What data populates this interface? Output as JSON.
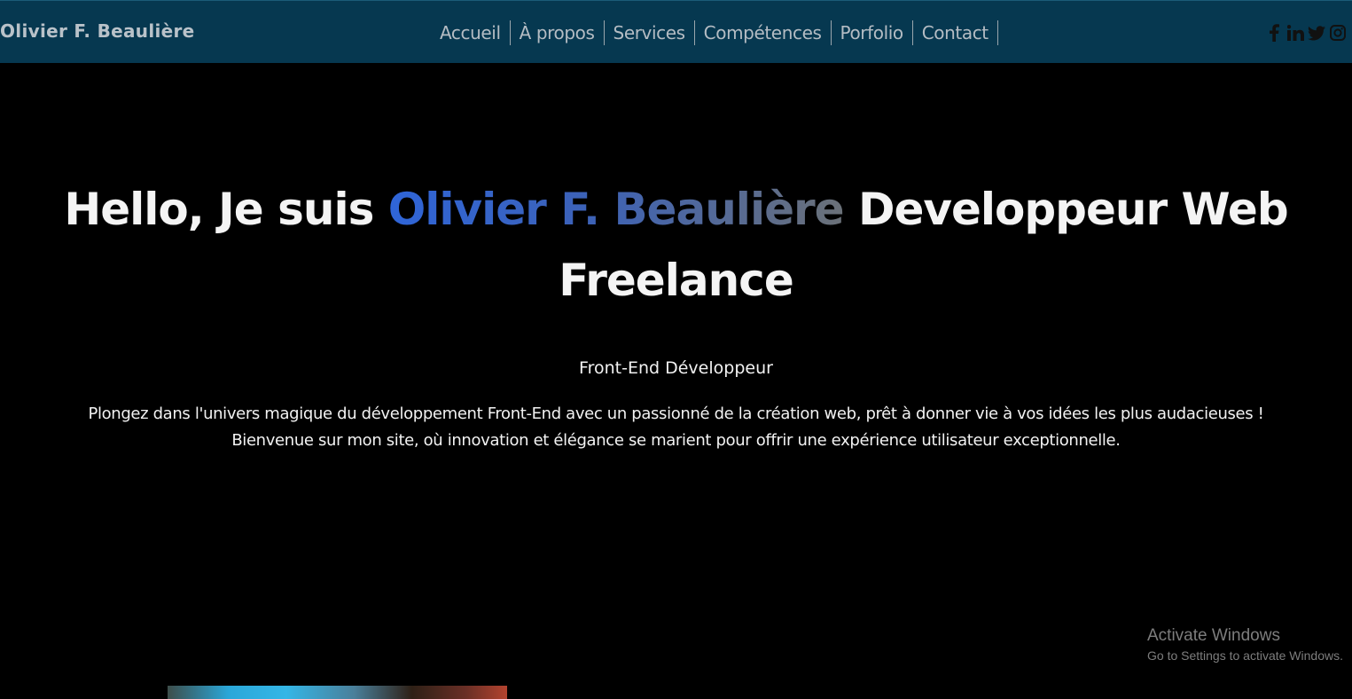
{
  "brand": {
    "name": "Olivier F. Beaulière"
  },
  "nav": {
    "links": [
      {
        "label": "Accueil"
      },
      {
        "label": "À propos"
      },
      {
        "label": "Services"
      },
      {
        "label": "Compétences"
      },
      {
        "label": "Porfolio"
      },
      {
        "label": "Contact"
      }
    ]
  },
  "socials": [
    {
      "icon": "facebook-icon"
    },
    {
      "icon": "linkedin-icon"
    },
    {
      "icon": "twitter-icon"
    },
    {
      "icon": "instagram-icon"
    }
  ],
  "hero": {
    "title_prefix": "Hello, Je suis ",
    "title_name": "Olivier F. Beaulière",
    "title_suffix": " Developpeur Web Freelance",
    "subtitle": "Front-End Développeur",
    "text": "Plongez dans l'univers magique du développement Front-End avec un passionné de la création web, prêt à donner vie à vos idées les plus audacieuses ! Bienvenue sur mon site, où innovation et élégance se marient pour offrir une expérience utilisateur exceptionnelle."
  },
  "watermark": {
    "title": "Activate Windows",
    "subtitle": "Go to Settings to activate Windows."
  },
  "colors": {
    "navbar_bg": "#063850",
    "page_bg": "#000000",
    "name_gradient_start": "#2f65d8",
    "name_gradient_end": "#6b7178",
    "nav_text": "#b4bcc3"
  }
}
